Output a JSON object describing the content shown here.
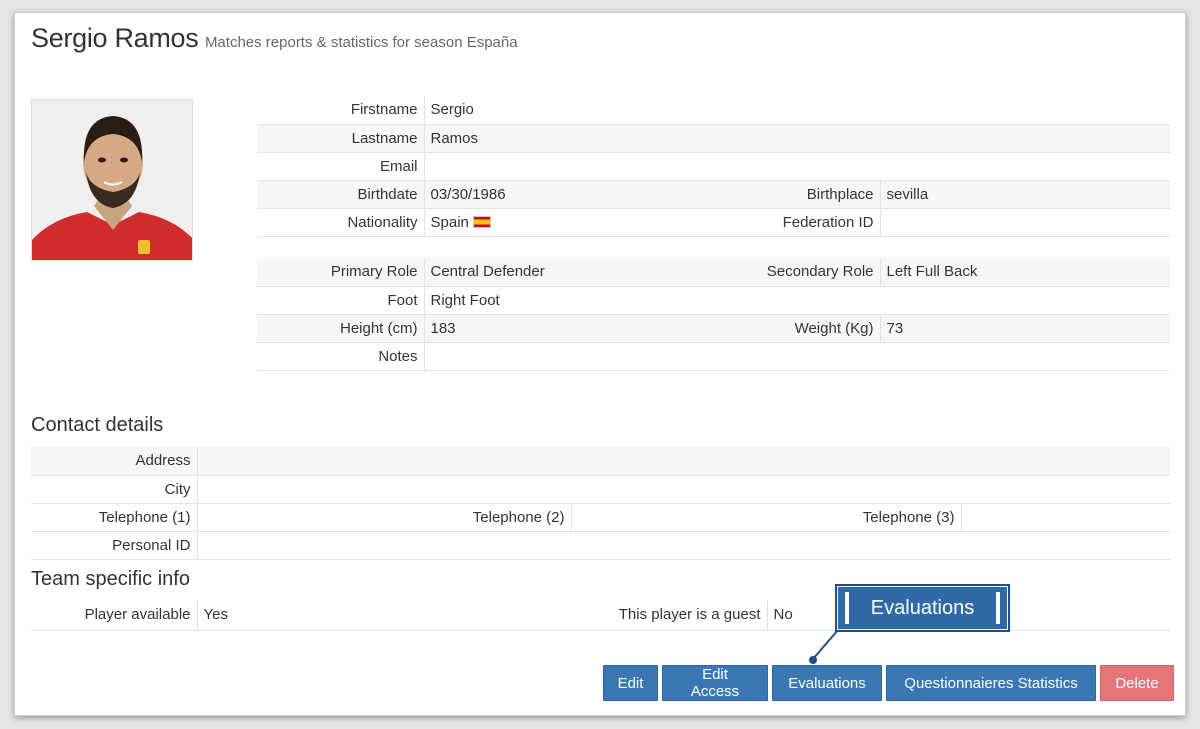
{
  "header": {
    "title": "Sergio Ramos",
    "subtitle": "Matches reports & statistics for season España"
  },
  "player": {
    "rows": [
      {
        "label": "Firstname",
        "value": "Sergio"
      },
      {
        "label": "Lastname",
        "value": "Ramos"
      },
      {
        "label": "Email",
        "value": ""
      },
      {
        "label": "Birthdate",
        "value": "03/30/1986",
        "label2": "Birthplace",
        "value2": "sevilla"
      },
      {
        "label": "Nationality",
        "value": "Spain",
        "label2": "Federation ID",
        "value2": ""
      }
    ],
    "rows2": [
      {
        "label": "Primary Role",
        "value": "Central Defender",
        "label2": "Secondary Role",
        "value2": "Left Full Back"
      },
      {
        "label": "Foot",
        "value": "Right Foot"
      },
      {
        "label": "Height (cm)",
        "value": "183",
        "label2": "Weight (Kg)",
        "value2": "73"
      },
      {
        "label": "Notes",
        "value": ""
      }
    ]
  },
  "contact": {
    "title": "Contact details",
    "address_label": "Address",
    "city_label": "City",
    "tel1_label": "Telephone (1)",
    "tel2_label": "Telephone (2)",
    "tel3_label": "Telephone (3)",
    "personal_id_label": "Personal ID"
  },
  "team": {
    "title": "Team specific info",
    "available_label": "Player available",
    "available_value": "Yes",
    "guest_label": "This player is a guest",
    "guest_value": "No"
  },
  "buttons": {
    "edit": "Edit",
    "edit_access": "Edit Access",
    "evaluations": "Evaluations",
    "questionnaires": "Questionnaieres Statistics",
    "delete": "Delete"
  },
  "callout": {
    "label": "Evaluations"
  },
  "colors": {
    "primary": "#3a78b5",
    "danger": "#e4767a",
    "callout": "#2e6aa8"
  }
}
